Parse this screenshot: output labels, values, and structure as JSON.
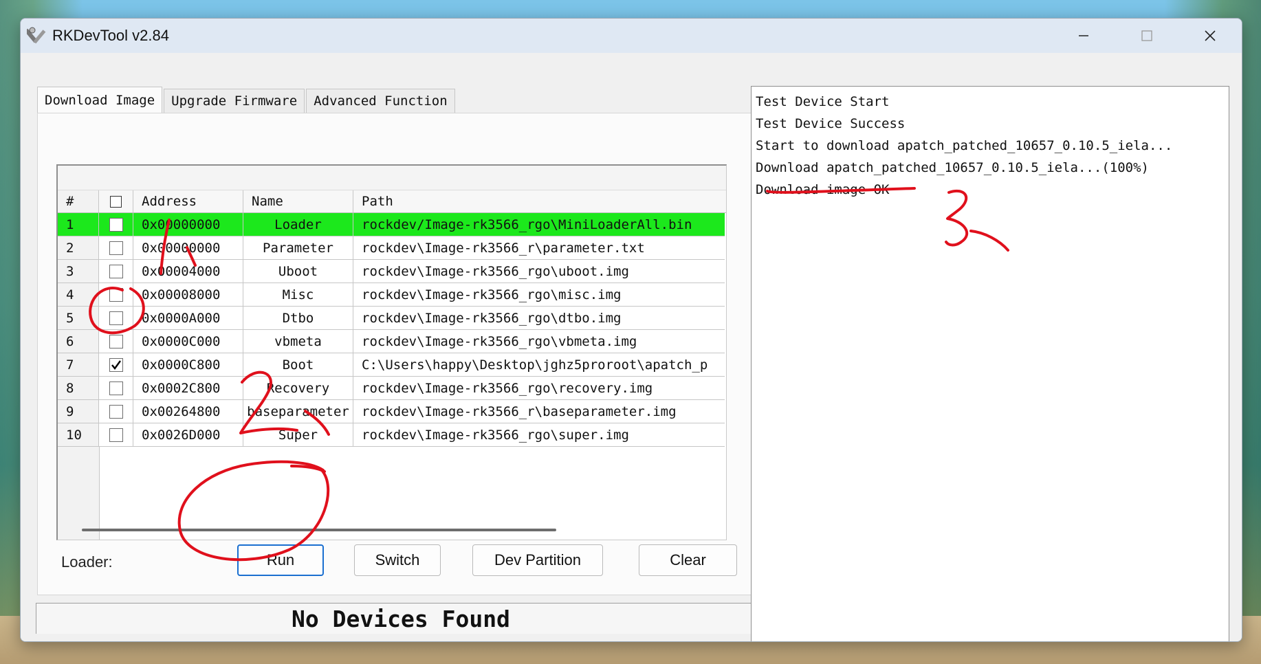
{
  "window": {
    "title": "RKDevTool v2.84",
    "minimize_icon": "minimize-icon",
    "maximize_icon": "maximize-icon",
    "close_icon": "close-icon"
  },
  "tabs": [
    {
      "label": "Download Image",
      "active": true
    },
    {
      "label": "Upgrade Firmware",
      "active": false
    },
    {
      "label": "Advanced Function",
      "active": false
    }
  ],
  "grid": {
    "headers": {
      "num": "#",
      "address": "Address",
      "name": "Name",
      "path": "Path"
    },
    "rows": [
      {
        "num": "1",
        "checked": false,
        "address": "0x00000000",
        "name": "Loader",
        "path": "rockdev/Image-rk3566_rgo\\MiniLoaderAll.bin",
        "highlight": true
      },
      {
        "num": "2",
        "checked": false,
        "address": "0x00000000",
        "name": "Parameter",
        "path": "rockdev\\Image-rk3566_r\\parameter.txt"
      },
      {
        "num": "3",
        "checked": false,
        "address": "0x00004000",
        "name": "Uboot",
        "path": "rockdev\\Image-rk3566_rgo\\uboot.img"
      },
      {
        "num": "4",
        "checked": false,
        "address": "0x00008000",
        "name": "Misc",
        "path": "rockdev\\Image-rk3566_rgo\\misc.img"
      },
      {
        "num": "5",
        "checked": false,
        "address": "0x0000A000",
        "name": "Dtbo",
        "path": "rockdev\\Image-rk3566_rgo\\dtbo.img"
      },
      {
        "num": "6",
        "checked": false,
        "address": "0x0000C000",
        "name": "vbmeta",
        "path": "rockdev\\Image-rk3566_rgo\\vbmeta.img"
      },
      {
        "num": "7",
        "checked": true,
        "address": "0x0000C800",
        "name": "Boot",
        "path": "C:\\Users\\happy\\Desktop\\jghz5proroot\\apatch_p"
      },
      {
        "num": "8",
        "checked": false,
        "address": "0x0002C800",
        "name": "Recovery",
        "path": "rockdev\\Image-rk3566_rgo\\recovery.img"
      },
      {
        "num": "9",
        "checked": false,
        "address": "0x00264800",
        "name": "baseparameter",
        "path": "rockdev\\Image-rk3566_r\\baseparameter.img"
      },
      {
        "num": "10",
        "checked": false,
        "address": "0x0026D000",
        "name": "Super",
        "path": "rockdev\\Image-rk3566_rgo\\super.img"
      }
    ]
  },
  "controls": {
    "loader_label": "Loader:",
    "run_label": "Run",
    "switch_label": "Switch",
    "dev_partition_label": "Dev Partition",
    "clear_label": "Clear"
  },
  "status": {
    "text": "No Devices Found"
  },
  "log": {
    "lines": [
      "Test Device Start",
      "Test Device Success",
      "Start to download apatch_patched_10657_0.10.5_iela...",
      "Download apatch_patched_10657_0.10.5_iela...(100%)",
      "Download image OK"
    ]
  },
  "annotations": {
    "color": "#e0101c",
    "marks": [
      "1、",
      "2、",
      "3、"
    ]
  }
}
